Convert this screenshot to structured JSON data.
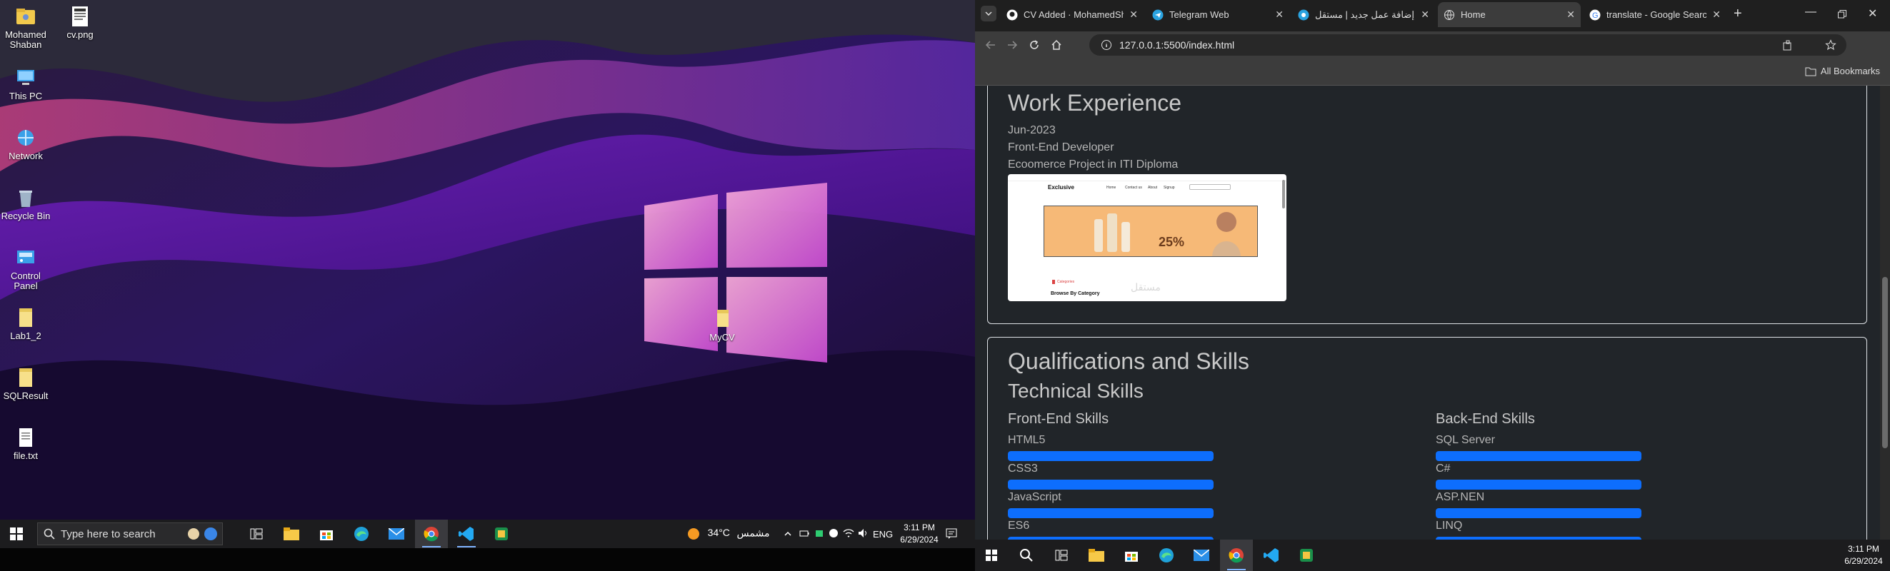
{
  "desktop": {
    "icons": [
      {
        "label": "Mohamed Shaban",
        "icon": "user-folder-icon"
      },
      {
        "label": "cv.png",
        "icon": "image-file-icon"
      },
      {
        "label": "This PC",
        "icon": "computer-icon"
      },
      {
        "label": "Network",
        "icon": "network-icon"
      },
      {
        "label": "Recycle Bin",
        "icon": "recycle-bin-icon"
      },
      {
        "label": "Control Panel",
        "icon": "control-panel-icon"
      },
      {
        "label": "Lab1_2",
        "icon": "folder-icon"
      },
      {
        "label": "SQLResult",
        "icon": "folder-icon"
      },
      {
        "label": "file.txt",
        "icon": "text-file-icon"
      },
      {
        "label": "MyCV",
        "icon": "folder-icon"
      }
    ]
  },
  "taskbar_left": {
    "search_placeholder": "Type here to search",
    "weather_temp": "34°C",
    "weather_text": "مشمس",
    "lang": "ENG",
    "time": "3:11 PM",
    "date": "6/29/2024"
  },
  "browser": {
    "tabs": [
      {
        "title": "CV Added · MohamedSh…",
        "icon": "github-icon",
        "active": false
      },
      {
        "title": "Telegram Web",
        "icon": "telegram-icon",
        "active": false
      },
      {
        "title": "إضافة عمل جديد | مستقل",
        "icon": "mostaql-icon",
        "active": false
      },
      {
        "title": "Home",
        "icon": "globe-icon",
        "active": true
      },
      {
        "title": "translate - Google Search",
        "icon": "google-icon",
        "active": false
      }
    ],
    "url": "127.0.0.1:5500/index.html",
    "bookmarks_label": "All Bookmarks"
  },
  "cv": {
    "work_heading": "Work Experience",
    "work_date": "Jun-2023",
    "work_role": "Front-End Developer",
    "work_project": "Ecoomerce Project in ITI Diploma",
    "preview": {
      "brand": "Exclusive",
      "nav": [
        "Home",
        "Contact us",
        "About",
        "Signup"
      ],
      "banner_text": "25%",
      "category": "Categories",
      "browse": "Browse By Category",
      "watermark": "مستقل"
    },
    "qual_heading": "Qualifications and Skills",
    "tech_heading": "Technical Skills",
    "frontend_heading": "Front-End Skills",
    "backend_heading": "Back-End Skills",
    "frontend_skills": [
      {
        "name": "HTML5",
        "level": 100
      },
      {
        "name": "CSS3",
        "level": 100
      },
      {
        "name": "JavaScript",
        "level": 100
      },
      {
        "name": "ES6",
        "level": 100
      }
    ],
    "backend_skills": [
      {
        "name": "SQL Server",
        "level": 100
      },
      {
        "name": "C#",
        "level": 100
      },
      {
        "name": "ASP.NEN",
        "level": 100
      },
      {
        "name": "LINQ",
        "level": 100
      }
    ]
  },
  "taskbar_right": {
    "time": "3:11 PM",
    "date": "6/29/2024"
  }
}
